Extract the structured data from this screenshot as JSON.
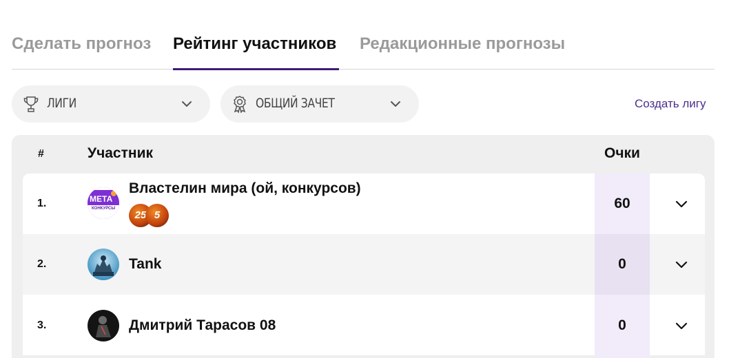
{
  "tabs": [
    {
      "label": "Сделать прогноз",
      "active": false
    },
    {
      "label": "Рейтинг участников",
      "active": true
    },
    {
      "label": "Редакционные прогнозы",
      "active": false
    }
  ],
  "filters": {
    "leagues_label": "ЛИГИ",
    "standings_label": "ОБЩИЙ ЗАЧЕТ",
    "create_league_link": "Создать лигу"
  },
  "table": {
    "headers": {
      "rank": "#",
      "participant": "Участник",
      "points": "Очки"
    },
    "rows": [
      {
        "rank": "1.",
        "name": "Властелин мира (ой, конкурсов)",
        "points": "60",
        "avatar_text": "МЕТА",
        "avatar_subtext": "КОНКУРСЫ",
        "badges": [
          "25",
          "5"
        ]
      },
      {
        "rank": "2.",
        "name": "Tank",
        "points": "0"
      },
      {
        "rank": "3.",
        "name": "Дмитрий Тарасов 08",
        "points": "0"
      }
    ]
  },
  "colors": {
    "accent": "#3e1a78",
    "link": "#4d2d8e",
    "points_highlight": "#f1ebfa",
    "badge_orange": "#e0701a"
  },
  "icons": {
    "leagues": "trophy-icon",
    "standings": "award-ribbon-icon",
    "dropdown": "chevron-down-icon",
    "expand": "chevron-down-icon"
  }
}
